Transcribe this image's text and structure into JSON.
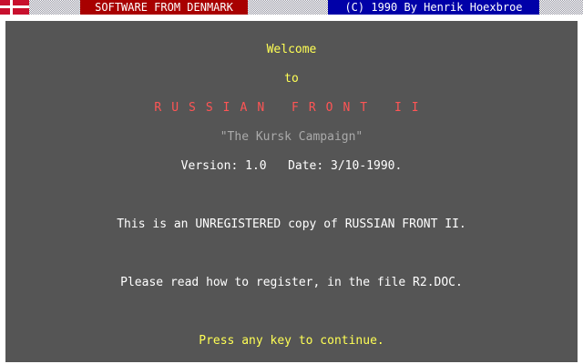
{
  "header": {
    "brand": "SOFTWARE FROM DENMARK",
    "credit": "(C) 1990 By Henrik Hoexbroe"
  },
  "screen": {
    "welcome": "Welcome",
    "to": "to",
    "title": "RUSSIAN FRONT II",
    "subtitle": "\"The Kursk Campaign\"",
    "version_line": "Version: 1.0   Date: 3/10-1990.",
    "unregistered": "This is an UNREGISTERED copy of RUSSIAN FRONT II.",
    "register_info": "Please read how to register, in the file R2.DOC.",
    "prompt": "Press any key to continue."
  },
  "colors": {
    "background": "#555555",
    "highlight": "#ffff55",
    "title": "#ff5555",
    "subtitle": "#aaaaaa",
    "text": "#ffffff",
    "brand_bar": "#a80000",
    "credit_bar": "#0000a8"
  }
}
